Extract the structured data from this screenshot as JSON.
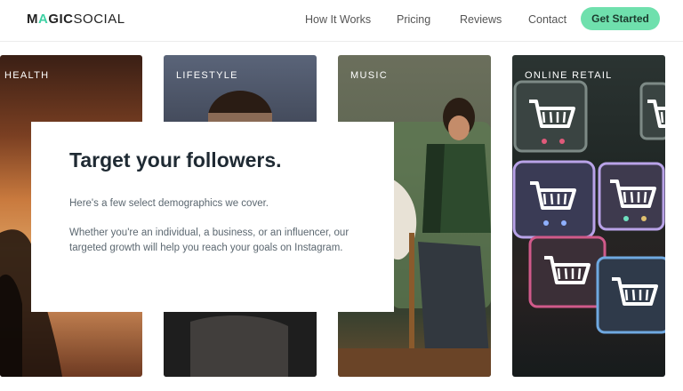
{
  "header": {
    "logo_prefix": "M",
    "logo_accent": "A",
    "logo_bold_rest": "GIC",
    "logo_thin": "SOCIAL",
    "nav": [
      "How It Works",
      "Pricing",
      "Reviews",
      "Contact"
    ],
    "cta": "Get Started"
  },
  "cards": [
    {
      "label": "HEALTH"
    },
    {
      "label": "LIFESTYLE"
    },
    {
      "label": "MUSIC"
    },
    {
      "label": "ONLINE RETAIL"
    }
  ],
  "panel": {
    "title": "Target your followers.",
    "intro": "Here's a few select demographics we cover.",
    "body": "Whether you're an individual, a business, or an influencer, our targeted growth will help you reach your goals on Instagram."
  },
  "colors": {
    "accent": "#6fe0ad",
    "logo_accent": "#3fd1a4",
    "title": "#1f2a33"
  },
  "icons": [
    "shopping-cart-icon"
  ]
}
